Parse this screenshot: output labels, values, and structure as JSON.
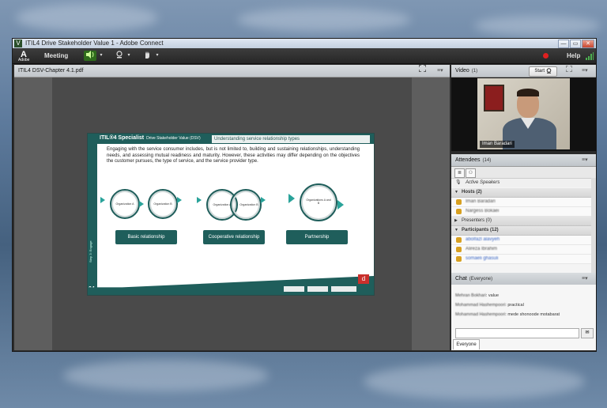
{
  "window": {
    "title": "ITIL4 Drive Stakeholder Value 1 - Adobe Connect",
    "minimize": "—",
    "maximize": "▭",
    "close": "✕"
  },
  "menubar": {
    "logo": "A",
    "logo_sub": "Adobe",
    "meeting_label": "Meeting",
    "help_label": "Help",
    "speaker_icon": "speaker-icon",
    "camera_icon": "webcam-icon",
    "raise_hand_icon": "raise-hand-icon",
    "record_color": "#e02020"
  },
  "share_pod": {
    "title": "ITIL4 DSV-Chapter 4.1.pdf",
    "menu": "≡▾",
    "fullscreen_icon": "fullscreen-icon"
  },
  "slide": {
    "title": "ITIL®4 Specialist",
    "title_sub": "Drive Stakeholder Value (DSV)",
    "subtitle": "Understanding service relationship types",
    "body": "Engaging with the service consumer includes, but is not limited to, building and sustaining relationships, understanding needs, and assessing mutual readiness and maturity. However, these activities may differ depending on the objectives the customer pursues, the type of service, and the service provider type.",
    "side_number": "04",
    "side_text": "Step 3: Engage",
    "org_a": "Organization A",
    "org_b": "Organization B",
    "org_ab": "Organizations A and B",
    "labels": [
      "Basic relationship",
      "Cooperative relationship",
      "Partnership"
    ],
    "corner_mark": "d",
    "accent_color": "#1f5e5b"
  },
  "video_pod": {
    "title": "Video",
    "count": "(1)",
    "start_label": "Start",
    "person_name": "Iman Baradari"
  },
  "attendees_pod": {
    "title": "Attendees",
    "count": "(14)",
    "active_speakers": "Active Speakers",
    "hosts": "Hosts (2)",
    "host_names": [
      "Iman Baradari",
      "Nargess Bokaei"
    ],
    "presenters": "Presenters (0)",
    "participants": "Participants (12)",
    "participant_names": [
      "abolfazl alavyeh",
      "Alireza Ibrahim",
      "somaeli ghasuli"
    ]
  },
  "chat_pod": {
    "title": "Chat",
    "scope": "(Everyone)",
    "messages": [
      {
        "who": "Mehran Bokhari",
        "text": ": value"
      },
      {
        "who": "Mohammad Hashempoori",
        "text": ": practical"
      },
      {
        "who": "Mohammad Hashempoori",
        "text": ": mede shonoode motabarat"
      }
    ],
    "tab": "Everyone"
  }
}
